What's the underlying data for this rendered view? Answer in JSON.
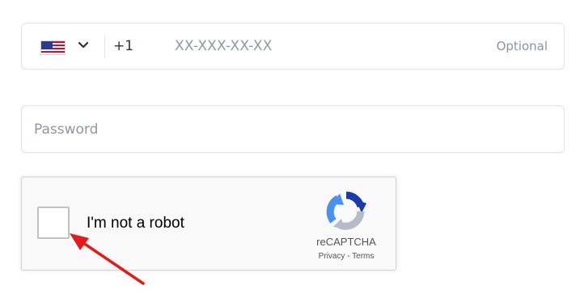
{
  "phone": {
    "country_flag": "us-flag-icon",
    "dial_code": "+1",
    "placeholder": "XX-XXX-XX-XX",
    "hint": "Optional"
  },
  "password": {
    "placeholder": "Password"
  },
  "captcha": {
    "label": "I'm not a robot",
    "brand": "reCAPTCHA",
    "links": "Privacy - Terms"
  },
  "colors": {
    "annotation_arrow": "#e51b1b",
    "field_border": "#dfe3e8",
    "placeholder_text": "#8e98a3"
  }
}
